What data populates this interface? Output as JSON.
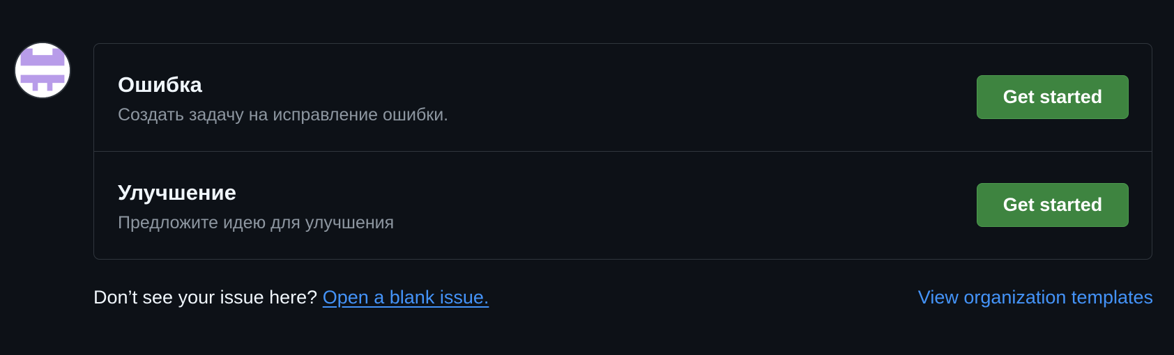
{
  "avatar": {
    "icon": "org-avatar-icon",
    "colors": {
      "primary": "#b89ce9",
      "background": "#ffffff"
    }
  },
  "templates": [
    {
      "title": "Ошибка",
      "description": "Создать задачу на исправление ошибки.",
      "button_label": "Get started"
    },
    {
      "title": "Улучшение",
      "description": "Предложите идею для улучшения",
      "button_label": "Get started"
    }
  ],
  "footer": {
    "prompt": "Don’t see your issue here?",
    "blank_issue_link": "Open a blank issue.",
    "org_templates_link": "View organization templates"
  },
  "colors": {
    "background": "#0d1117",
    "border": "#30363d",
    "button": "#3e8440",
    "link": "#4493f8",
    "muted_text": "#8d96a0"
  }
}
